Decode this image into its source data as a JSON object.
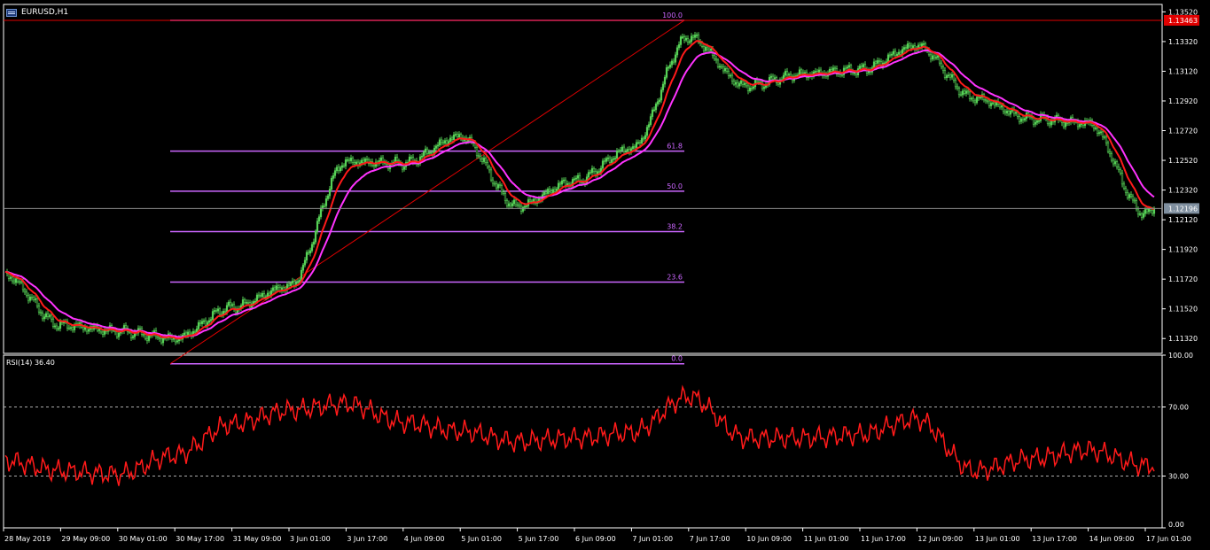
{
  "window": {
    "symbol_title": "EURUSD,H1"
  },
  "colors": {
    "background": "#000000",
    "frame": "#ffffff",
    "bull_candle": "#56d156",
    "ma_fast": "#ff1a1a",
    "ma_slow": "#ff33ff",
    "fibo": "#cc66ff",
    "high_line": "#e00000",
    "bid_line": "#888888",
    "rsi": "#ff1a1a",
    "level_grid": "#aaaaaa",
    "axis_text": "#ffffff",
    "high_label_bg": "#e00000",
    "bid_label_bg": "#7f8f9f"
  },
  "price_axis": {
    "labels": [
      "1.13520",
      "1.13320",
      "1.13120",
      "1.12920",
      "1.12720",
      "1.12520",
      "1.12320",
      "1.12120",
      "1.11920",
      "1.11720",
      "1.11520",
      "1.11320"
    ],
    "high_label": "1.13463",
    "bid_label": "1.12196"
  },
  "fibonacci": {
    "levels": [
      {
        "label": "100.0",
        "price": 1.13463
      },
      {
        "label": "61.8",
        "price": 1.12582
      },
      {
        "label": "50.0",
        "price": 1.12312
      },
      {
        "label": "38.2",
        "price": 1.1204
      },
      {
        "label": "23.6",
        "price": 1.117
      },
      {
        "label": "0.0",
        "price": 1.1115
      }
    ]
  },
  "rsi": {
    "title": "RSI(14) 36.40",
    "axis_labels": [
      "100.00",
      "70.00",
      "30.00",
      "0.00"
    ],
    "levels": [
      70,
      30
    ]
  },
  "time_axis": {
    "labels": [
      "28 May 2019",
      "29 May 09:00",
      "30 May 01:00",
      "30 May 17:00",
      "31 May 09:00",
      "3 Jun 01:00",
      "3 Jun 17:00",
      "4 Jun 09:00",
      "5 Jun 01:00",
      "5 Jun 17:00",
      "6 Jun 09:00",
      "7 Jun 01:00",
      "7 Jun 17:00",
      "10 Jun 09:00",
      "11 Jun 01:00",
      "11 Jun 17:00",
      "12 Jun 09:00",
      "13 Jun 01:00",
      "13 Jun 17:00",
      "14 Jun 09:00",
      "17 Jun 01:00"
    ]
  },
  "chart_data": {
    "type": "line",
    "title": "EURUSD,H1",
    "x": [
      "28 May 2019",
      "29 May 09:00",
      "30 May 01:00",
      "30 May 17:00",
      "31 May 09:00",
      "3 Jun 01:00",
      "3 Jun 17:00",
      "4 Jun 09:00",
      "5 Jun 01:00",
      "5 Jun 17:00",
      "6 Jun 09:00",
      "7 Jun 01:00",
      "7 Jun 17:00",
      "10 Jun 09:00",
      "11 Jun 01:00",
      "11 Jun 17:00",
      "12 Jun 09:00",
      "13 Jun 01:00",
      "13 Jun 17:00",
      "14 Jun 09:00",
      "17 Jun 01:00"
    ],
    "ylim": [
      1.1122,
      1.1357
    ],
    "grid": false,
    "series": [
      {
        "values": [
          1.1175,
          1.1141,
          1.1137,
          1.1132,
          1.1153,
          1.1167,
          1.1251,
          1.125,
          1.1268,
          1.1221,
          1.1238,
          1.126,
          1.1335,
          1.1302,
          1.131,
          1.1313,
          1.1329,
          1.1294,
          1.128,
          1.1277,
          1.1216
        ]
      }
    ],
    "rsi_values": [
      39,
      33,
      31,
      42,
      60,
      68,
      72,
      61,
      56,
      50,
      52,
      55,
      76,
      52,
      52,
      54,
      63,
      33,
      40,
      45,
      36
    ],
    "rsi_ylim": [
      0,
      100
    ]
  }
}
